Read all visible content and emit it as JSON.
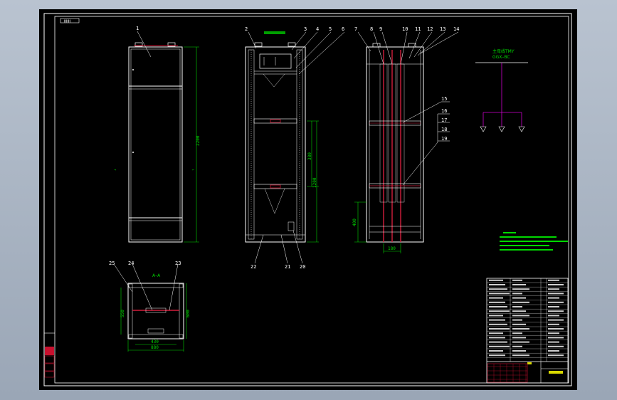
{
  "title_block_tag": "HHH",
  "part_numbers": [
    "1",
    "2",
    "3",
    "4",
    "5",
    "6",
    "7",
    "8",
    "9",
    "10",
    "11",
    "12",
    "13",
    "14",
    "15",
    "16",
    "17",
    "18",
    "19",
    "20",
    "21",
    "22",
    "23",
    "24",
    "25"
  ],
  "dimensions": {
    "front_height": "2200",
    "mid_span": "380",
    "lower_span": "1200",
    "side_base": "400",
    "side_width": "180",
    "plan_outer_width": "880",
    "plan_inner_width": "430",
    "plan_depth_left": "550",
    "plan_depth_right": "600"
  },
  "section_label": "A–A",
  "schematic": {
    "bus_label_line1": "主母线TMY",
    "bus_label_line2": "GGX–BC"
  },
  "colors": {
    "background": "#000000",
    "frame": "#ffffff",
    "dimension": "#00d800",
    "busbar": "#d21e3c",
    "schematic_bus": "#d000d0",
    "note_text": "#00ff00"
  }
}
